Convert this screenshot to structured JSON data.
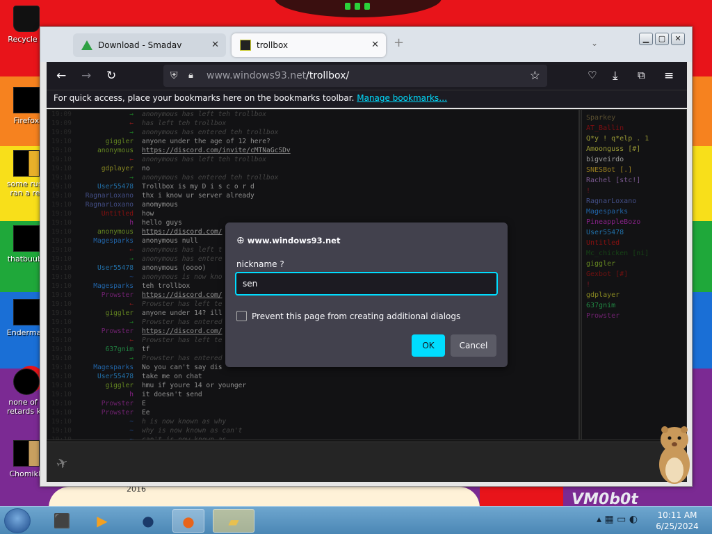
{
  "desktop": {
    "icons": [
      {
        "label": "Recycle B"
      },
      {
        "label": "Firefox"
      },
      {
        "label": "some russ ran a ret"
      },
      {
        "label": "thatbuubt"
      },
      {
        "label": "Enderman"
      },
      {
        "label": "none of y retards kn"
      },
      {
        "label": "ChomikB"
      }
    ],
    "year_label": "2016",
    "brand_label": "VM0b0t"
  },
  "browser": {
    "tabs": [
      {
        "label": "Download - Smadav"
      },
      {
        "label": "trollbox"
      }
    ],
    "url_host": "www.windows93.net",
    "url_path": "/trollbox/",
    "bookmarks_text": "For quick access, place your bookmarks here on the bookmarks toolbar.",
    "bookmarks_link": "Manage bookmarks…"
  },
  "chat": {
    "messages": [
      {
        "time": "19:09",
        "nick": "→",
        "text": "anonymous has left teh trollbox",
        "type": "sys"
      },
      {
        "time": "19:09",
        "nick": "←",
        "text": "has left teh trollbox",
        "type": "sys"
      },
      {
        "time": "19:09",
        "nick": "→",
        "text": "anonymous has entered teh trollbox",
        "type": "sys"
      },
      {
        "time": "19:10",
        "nick": "giggler",
        "text": "anyone under the age of 12 here?",
        "type": "msg"
      },
      {
        "time": "19:10",
        "nick": "anonymous",
        "text": "https://discord.com/invite/cMTNaGcSDv",
        "type": "link"
      },
      {
        "time": "19:10",
        "nick": "←",
        "text": "anonymous has left teh trollbox",
        "type": "sys"
      },
      {
        "time": "19:10",
        "nick": "gdplayer",
        "text": "no",
        "type": "msg"
      },
      {
        "time": "19:10",
        "nick": "→",
        "text": "anonymous has entered teh trollbox",
        "type": "sys"
      },
      {
        "time": "19:10",
        "nick": "User55478",
        "text": "Trollbox is my D i s c o r d",
        "type": "msg"
      },
      {
        "time": "19:10",
        "nick": "RagnarLoxano",
        "text": "thx i know ur server already",
        "type": "msg"
      },
      {
        "time": "19:10",
        "nick": "RagnarLoxano",
        "text": "anomymous",
        "type": "msg"
      },
      {
        "time": "19:10",
        "nick": "Untitled",
        "text": "how",
        "type": "msg"
      },
      {
        "time": "19:10",
        "nick": "h",
        "text": "hello guys",
        "type": "msg"
      },
      {
        "time": "19:10",
        "nick": "anonymous",
        "text": "https://discord.com/",
        "type": "link"
      },
      {
        "time": "19:10",
        "nick": "Magesparks",
        "text": "anonymous null",
        "type": "msg"
      },
      {
        "time": "19:10",
        "nick": "←",
        "text": "anonymous has left t",
        "type": "sys"
      },
      {
        "time": "19:10",
        "nick": "→",
        "text": "anonymous has entere",
        "type": "sys"
      },
      {
        "time": "19:10",
        "nick": "User55478",
        "text": "anonymous (oooo)",
        "type": "msg"
      },
      {
        "time": "19:10",
        "nick": "~",
        "text": "anonymous is now kno",
        "type": "sys"
      },
      {
        "time": "19:10",
        "nick": "Magesparks",
        "text": "teh trollbox",
        "type": "msg"
      },
      {
        "time": "19:10",
        "nick": "Prowster",
        "text": "https://discord.com/",
        "type": "link"
      },
      {
        "time": "19:10",
        "nick": "←",
        "text": "Prowster has left te",
        "type": "sys"
      },
      {
        "time": "19:10",
        "nick": "giggler",
        "text": "anyone under 14? ill",
        "type": "msg"
      },
      {
        "time": "19:10",
        "nick": "→",
        "text": "Prowster has entered",
        "type": "sys"
      },
      {
        "time": "19:10",
        "nick": "Prowster",
        "text": "https://discord.com/",
        "type": "link"
      },
      {
        "time": "19:10",
        "nick": "←",
        "text": "Prowster has left te",
        "type": "sys"
      },
      {
        "time": "19:10",
        "nick": "637gnim",
        "text": "tf",
        "type": "msg"
      },
      {
        "time": "19:10",
        "nick": "→",
        "text": "Prowster has entered",
        "type": "sys"
      },
      {
        "time": "19:10",
        "nick": "Magesparks",
        "text": "No you can't say dis",
        "type": "msg"
      },
      {
        "time": "19:10",
        "nick": "User55478",
        "text": "take me on chat",
        "type": "msg"
      },
      {
        "time": "19:10",
        "nick": "giggler",
        "text": "hmu if youre 14 or younger",
        "type": "msg"
      },
      {
        "time": "19:10",
        "nick": "h",
        "text": "it doesn't send",
        "type": "msg"
      },
      {
        "time": "19:10",
        "nick": "Prowster",
        "text": "E",
        "type": "msg"
      },
      {
        "time": "19:10",
        "nick": "Prowster",
        "text": "Ee",
        "type": "msg"
      },
      {
        "time": "19:10",
        "nick": "~",
        "text": "h is now known as why",
        "type": "sys"
      },
      {
        "time": "19:10",
        "nick": "~",
        "text": "why is now known as can't",
        "type": "sys"
      },
      {
        "time": "19:10",
        "nick": "~",
        "text": "can't is now known as",
        "type": "sys"
      }
    ],
    "users": [
      {
        "name": "Sparkey",
        "color": "#8a7a4a"
      },
      {
        "name": "AT_Ballin",
        "color": "#c0141a"
      },
      {
        "name": "Q*y ! q*elp . 1",
        "color": "#e8e850"
      },
      {
        "name": "Amoonguss [#]",
        "color": "#e8e850"
      },
      {
        "name": "bigveirdo",
        "color": "#e8e8e8"
      },
      {
        "name": "SNESBot [.]",
        "color": "#e8c030"
      },
      {
        "name": "Rachel [stc!]",
        "color": "#bb88dd"
      },
      {
        "name": "!",
        "color": "#bb2233"
      },
      {
        "name": "RagnarLoxano",
        "color": "#6677cc"
      },
      {
        "name": "Magesparks",
        "color": "#3399ff"
      },
      {
        "name": "PineappleBozo",
        "color": "#cc33cc"
      },
      {
        "name": "User55478",
        "color": "#33aaff"
      },
      {
        "name": "Untitled",
        "color": "#cc1a1a"
      },
      {
        "name": "Mc_chicken [ni]",
        "color": "#226622"
      },
      {
        "name": "giggler",
        "color": "#99cc33"
      },
      {
        "name": "Gexbot [#]",
        "color": "#aa1a1a"
      },
      {
        "name": "!",
        "color": "#bb2233"
      },
      {
        "name": "gdplayer",
        "color": "#cccc33"
      },
      {
        "name": "637gnim",
        "color": "#33cc66"
      },
      {
        "name": "Prowster",
        "color": "#aa33aa"
      }
    ]
  },
  "dialog": {
    "origin": "www.windows93.net",
    "label": "nickname ?",
    "value": "sen",
    "checkbox_label": "Prevent this page from creating additional dialogs",
    "ok_label": "OK",
    "cancel_label": "Cancel"
  },
  "taskbar": {
    "time": "10:11 AM",
    "date": "6/25/2024"
  }
}
